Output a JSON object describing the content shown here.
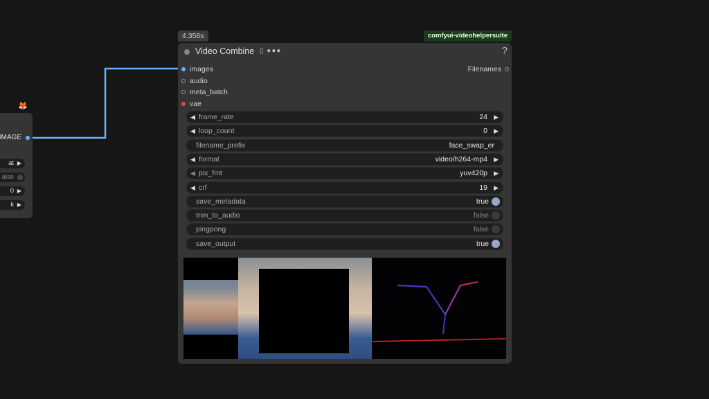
{
  "left_node": {
    "output_label": "IMAGE",
    "widgets": [
      {
        "text": "at",
        "kind": "arrow"
      },
      {
        "text": "alse",
        "kind": "toggle"
      },
      {
        "text": "0",
        "kind": "arrow"
      },
      {
        "text": "k",
        "kind": "arrow"
      }
    ]
  },
  "node": {
    "execution_time": "4.356s",
    "package_badge": "comfyui-videohelpersuite",
    "title": "Video Combine",
    "title_icons": "▯ ●●●",
    "help": "?",
    "inputs": [
      "images",
      "audio",
      "meta_batch",
      "vae"
    ],
    "output": "Filenames",
    "widgets": {
      "frame_rate": {
        "name": "frame_rate",
        "value": "24"
      },
      "loop_count": {
        "name": "loop_count",
        "value": "0"
      },
      "filename_prefix": {
        "name": "filename_prefix",
        "value": "face_swap_er"
      },
      "format": {
        "name": "format",
        "value": "video/h264-mp4"
      },
      "pix_fmt": {
        "name": "pix_fmt",
        "value": "yuv420p"
      },
      "crf": {
        "name": "crf",
        "value": "19"
      },
      "save_metadata": {
        "name": "save_metadata",
        "value": "true"
      },
      "trim_to_audio": {
        "name": "trim_to_audio",
        "value": "false"
      },
      "pingpong": {
        "name": "pingpong",
        "value": "false"
      },
      "save_output": {
        "name": "save_output",
        "value": "true"
      }
    }
  },
  "colors": {
    "canvas": "#161616",
    "node_bg": "#353535",
    "widget_bg": "#1f1f1f",
    "link_image": "#6ab0ff",
    "vae_dot": "#e04848",
    "badge_green": "#1d3a1d"
  },
  "icons": {
    "left_title": "fox-icon",
    "help": "question-icon",
    "arrow_left": "triangle-left-icon",
    "arrow_right": "triangle-right-icon"
  }
}
